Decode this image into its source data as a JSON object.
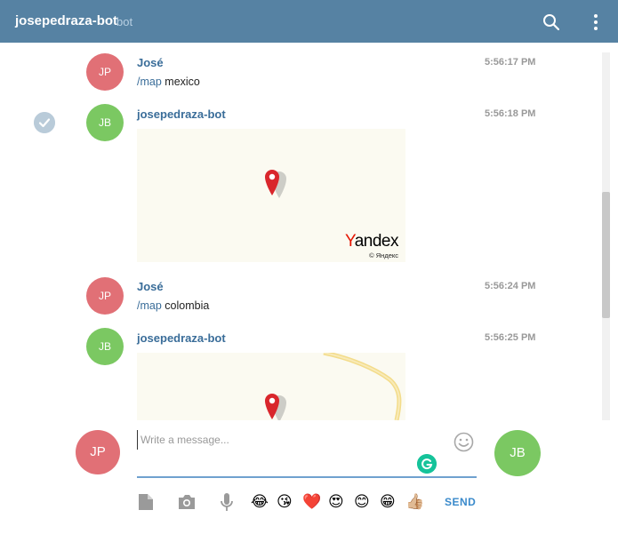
{
  "header": {
    "title": "josepedraza-bot",
    "subtitle": "bot"
  },
  "messages": [
    {
      "initials": "JP",
      "sender": "José",
      "time": "5:56:17 PM",
      "command": "/map",
      "arg": "mexico"
    },
    {
      "initials": "JB",
      "sender": "josepedraza-bot",
      "time": "5:56:18 PM",
      "map_brand": "Yandex",
      "map_brand_first": "Y",
      "map_brand_rest": "andex",
      "map_copyright": "© Яндекс"
    },
    {
      "initials": "JP",
      "sender": "José",
      "time": "5:56:24 PM",
      "command": "/map",
      "arg": "colombia"
    },
    {
      "initials": "JB",
      "sender": "josepedraza-bot",
      "time": "5:56:25 PM"
    }
  ],
  "composer": {
    "placeholder": "Write a message...",
    "left_avatar": "JP",
    "right_avatar": "JB",
    "send_label": "SEND",
    "emojis": [
      "😂",
      "😘",
      "❤️",
      "😍",
      "😊",
      "😁",
      "👍🏼"
    ]
  },
  "icons": [
    "search-icon",
    "more-icon",
    "check-icon",
    "map-pin-icon",
    "smile-icon",
    "grammarly-icon",
    "file-icon",
    "camera-icon",
    "microphone-icon"
  ],
  "colors": {
    "header": "#5682a3",
    "avatar_red": "#e17076",
    "avatar_green": "#7bc862",
    "link": "#3a6d99",
    "send": "#3a8acb"
  }
}
